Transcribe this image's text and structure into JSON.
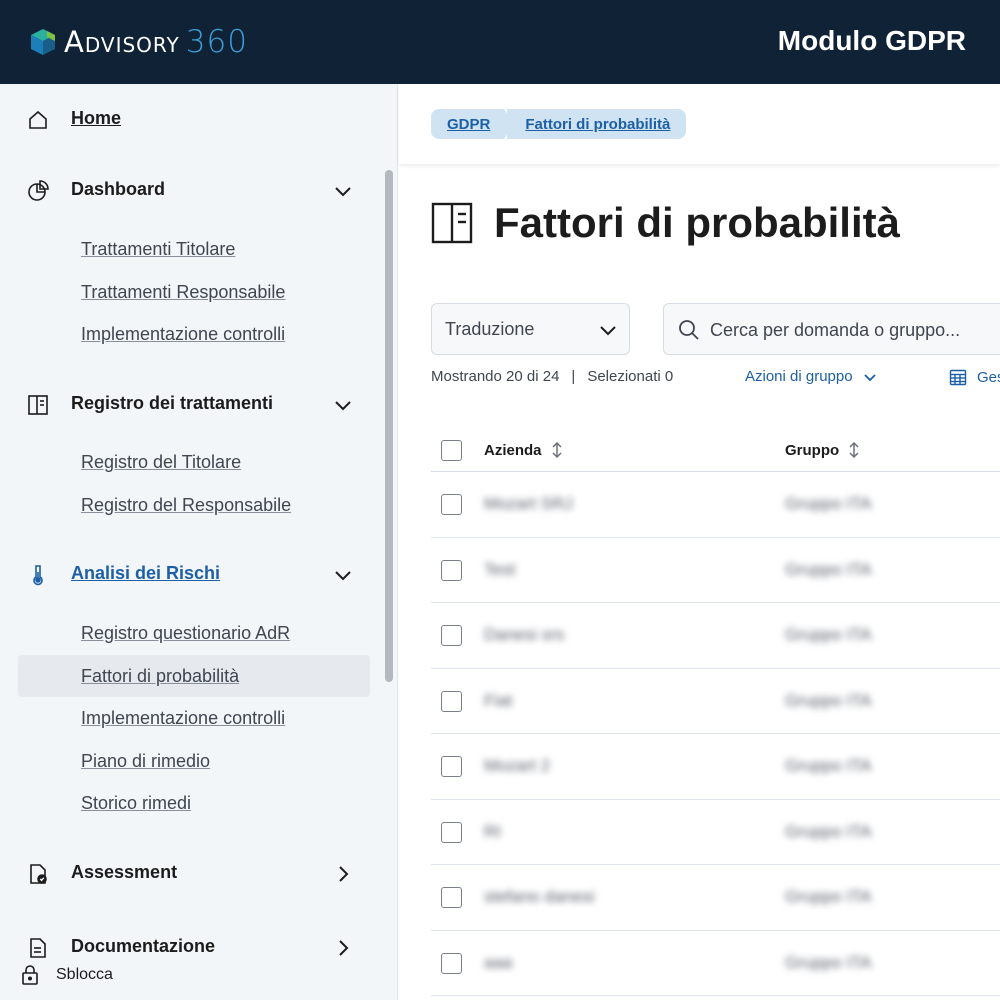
{
  "header": {
    "logo_text": "Advisory",
    "logo_number": "360",
    "module_title": "Modulo GDPR",
    "colors": {
      "background": "#0f2236",
      "accent": "#3aa0d8"
    }
  },
  "sidebar": {
    "home": {
      "label": "Home",
      "icon": "home-icon"
    },
    "sections": [
      {
        "label": "Dashboard",
        "icon": "pie-chart-icon",
        "expanded": true,
        "items": [
          "Trattamenti Titolare",
          "Trattamenti Responsabile",
          "Implementazione controlli"
        ]
      },
      {
        "label": "Registro dei trattamenti",
        "icon": "book-icon",
        "expanded": true,
        "items": [
          "Registro del Titolare",
          "Registro del Responsabile"
        ]
      },
      {
        "label": "Analisi dei Rischi",
        "icon": "thermometer-icon",
        "expanded": true,
        "active": true,
        "items": [
          "Registro questionario AdR",
          "Fattori di probabilità",
          "Implementazione controlli",
          "Piano di rimedio",
          "Storico rimedi"
        ],
        "selected_item": "Fattori di probabilità"
      },
      {
        "label": "Assessment",
        "icon": "document-check-icon",
        "expanded": false
      },
      {
        "label": "Documentazione",
        "icon": "document-icon",
        "expanded": false
      }
    ],
    "unlock_label": "Sblocca"
  },
  "breadcrumb": [
    "GDPR",
    "Fattori di probabilità"
  ],
  "page": {
    "title": "Fattori di probabilità",
    "select_value": "Traduzione",
    "search_placeholder": "Cerca per domanda o gruppo...",
    "showing": "Mostrando 20 di 24",
    "selected": "Selezionati 0",
    "group_actions": "Azioni di gruppo",
    "manage_label": "Ges"
  },
  "table": {
    "columns": [
      "Azienda",
      "Gruppo"
    ],
    "rows": [
      {
        "azienda": "Mozart SRJ",
        "gruppo": "Gruppo ITA"
      },
      {
        "azienda": "Test",
        "gruppo": "Gruppo ITA"
      },
      {
        "azienda": "Danesi srs",
        "gruppo": "Gruppo ITA"
      },
      {
        "azienda": "Fiat",
        "gruppo": "Gruppo ITA"
      },
      {
        "azienda": "Mozart 2",
        "gruppo": "Gruppo ITA"
      },
      {
        "azienda": "RI",
        "gruppo": "Gruppo ITA"
      },
      {
        "azienda": "stefano danesi",
        "gruppo": "Gruppo ITA"
      },
      {
        "azienda": "aaa",
        "gruppo": "Gruppo ITA"
      }
    ]
  }
}
